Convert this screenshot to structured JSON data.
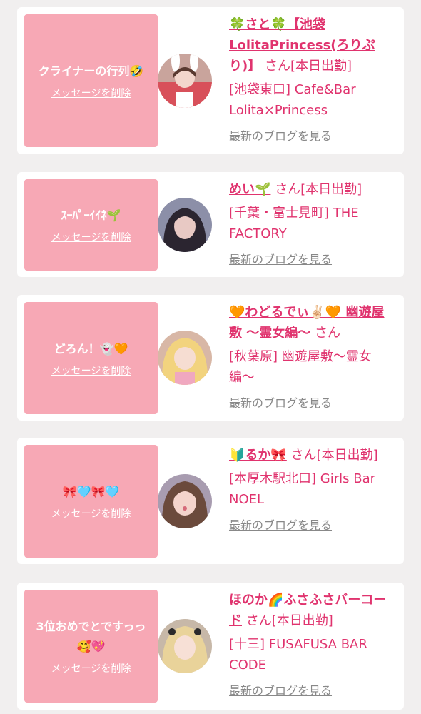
{
  "delete_label": "メッセージを削除",
  "san_label": "さん",
  "blog_label": "最新のブログを見る",
  "colors": {
    "accent": "#e0336e",
    "bubble": "#f7a8b5",
    "background": "#f1efef"
  },
  "cards": [
    {
      "message": "クライナーの行列🤣",
      "name": "🍀さと🍀【池袋LolitaPrincess(ろりぷり)】",
      "status": "[本日出勤]",
      "shop": "[池袋東口] Cafe&Bar Lolita×Princess"
    },
    {
      "message": "ｽｰﾊﾟｰｲｲﾈ🌱",
      "name": "めい🌱",
      "status": "[本日出勤]",
      "shop": "[千葉・富士見町] THE FACTORY"
    },
    {
      "message": "どろん！👻🧡",
      "name": "🧡わどるでぃ✌🏻🧡 幽遊屋敷 〜霊女編〜",
      "status": "",
      "shop": "[秋葉原] 幽遊屋敷〜霊女編〜"
    },
    {
      "message": "🎀🩵🎀🩵",
      "name": "🔰るか🎀",
      "status": "[本日出勤]",
      "shop": "[本厚木駅北口] Girls Bar NOEL"
    },
    {
      "message": "3位おめでとですっっ🥰💖",
      "name": "ほのか🌈ふさふさバーコード",
      "status": "[本日出勤]",
      "shop": "[十三] FUSAFUSA BAR CODE"
    }
  ]
}
